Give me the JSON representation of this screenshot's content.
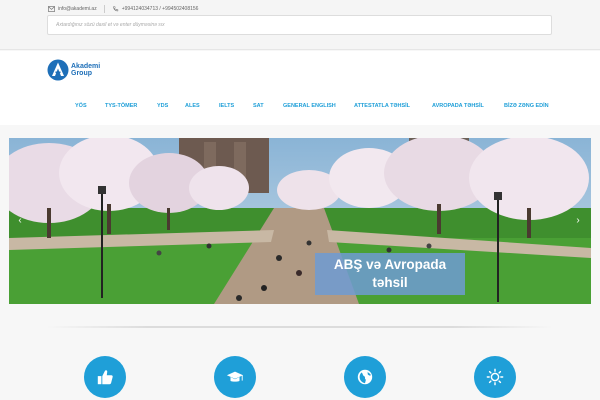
{
  "topbar": {
    "email": "info@akademi.az",
    "phones": "+994124034713 / +994502408156",
    "search_placeholder": "Axtardığınız sözü daxil et və enter düyməsinə sıx"
  },
  "brand": {
    "line1": "Akademi",
    "line2": "Group"
  },
  "nav": {
    "items": [
      "YÖS",
      "TYS-TÖMER",
      "YDS",
      "ALES",
      "IELTS",
      "SAT",
      "GENERAL ENGLISH",
      "ATTESTATLA TƏHSİL",
      "AVROPADA TƏHSİL",
      "BİZƏ ZƏNG EDİN"
    ]
  },
  "slider": {
    "caption_line1": "ABŞ və Avropada",
    "caption_line2": "təhsil",
    "prev_icon": "chevron-left-icon",
    "next_icon": "chevron-right-icon"
  },
  "features": [
    "thumbs-up-icon",
    "graduation-cap-icon",
    "globe-icon",
    "sun-icon"
  ],
  "colors": {
    "accent": "#1f9fd8",
    "brand": "#1e6fb8",
    "caption_bg": "#6e9bd2"
  }
}
